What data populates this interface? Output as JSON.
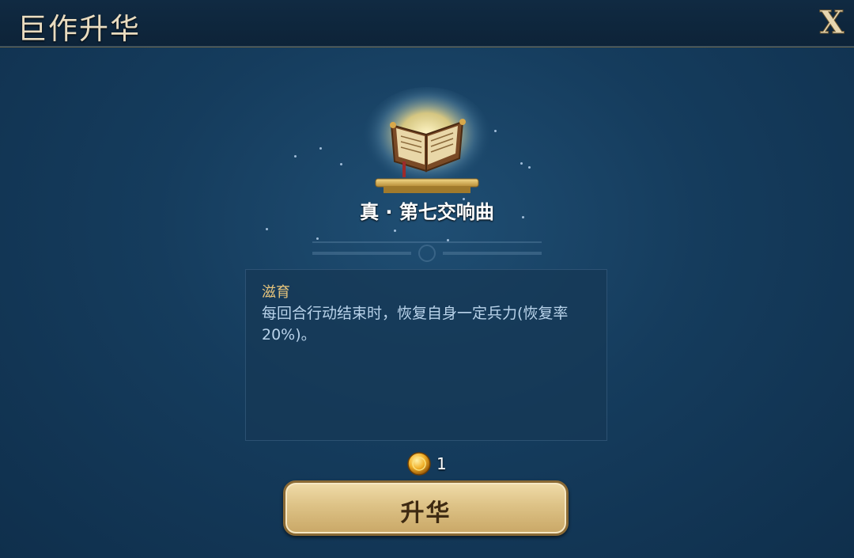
{
  "header": {
    "title": "巨作升华",
    "close_label": "X"
  },
  "item": {
    "name": "真 · 第七交响曲",
    "icon": "open-book-icon"
  },
  "skill": {
    "name": "滋育",
    "description": "每回合行动结束时，恢复自身一定兵力(恢复率20%)。"
  },
  "cost": {
    "icon": "gold-coin-icon",
    "value": "1"
  },
  "upgrade_button": {
    "label": "升华"
  },
  "colors": {
    "background": "#153c5d",
    "title": "#e9dcc0",
    "skill_name": "#e8c57c",
    "skill_desc": "#b9d3ea",
    "button": "#ddc286"
  }
}
